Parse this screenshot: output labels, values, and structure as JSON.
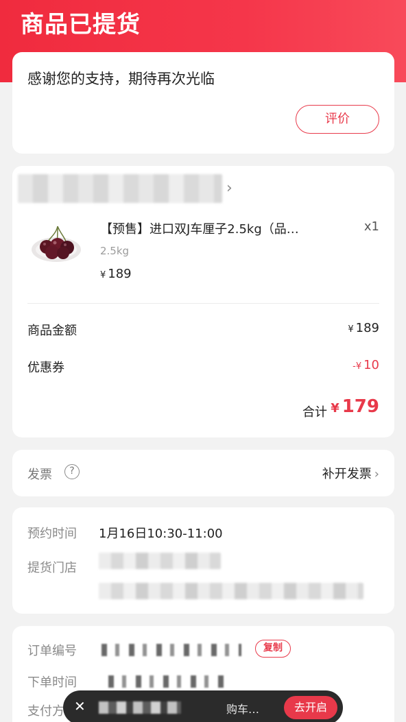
{
  "header": {
    "title": "商品已提货"
  },
  "status_card": {
    "message": "感谢您的支持，期待再次光临",
    "review_button": "评价"
  },
  "order_card": {
    "store_chevron": "›",
    "product": {
      "name": "【预售】进口双J车厘子2.5kg（品…",
      "qty": "x1",
      "spec": "2.5kg",
      "price_symbol": "¥",
      "price": "189"
    },
    "rows": [
      {
        "label": "商品金额",
        "symbol": "¥",
        "value": "189"
      },
      {
        "label": "优惠券",
        "symbol": "-¥",
        "value": "10"
      }
    ],
    "total_label": "合计",
    "total_symbol": "¥",
    "total_value": "179"
  },
  "invoice_card": {
    "label": "发票",
    "help": "?",
    "action": "补开发票",
    "chevron": "›"
  },
  "pickup_card": {
    "time_label": "预约时间",
    "time_value": "1月16日10:30-11:00",
    "store_label": "提货门店"
  },
  "order_info_card": {
    "order_no_label": "订单编号",
    "copy_button": "复制",
    "order_time_label": "下单时间",
    "payment_label": "支付方式"
  },
  "toast": {
    "close": "✕",
    "text": "购车…",
    "button": "去开启"
  },
  "colors": {
    "brand_red": "#e8394a",
    "header_gradient_start": "#f02b3e"
  }
}
